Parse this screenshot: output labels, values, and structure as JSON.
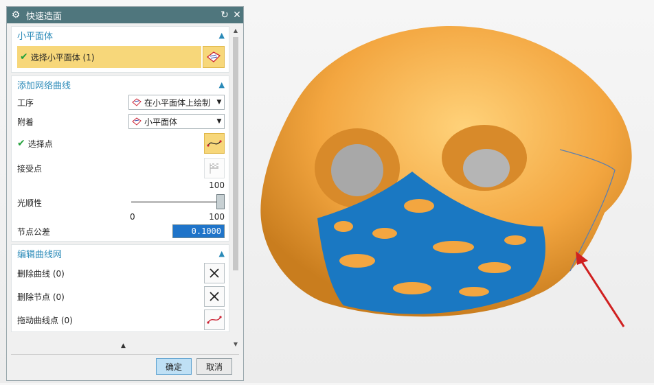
{
  "dialog": {
    "title": "快速造面",
    "sections": {
      "facet": {
        "header": "小平面体",
        "select_label": "选择小平面体 (1)"
      },
      "network": {
        "header": "添加网络曲线",
        "procedure_label": "工序",
        "procedure_value": "在小平面体上绘制",
        "attach_label": "附着",
        "attach_value": "小平面体",
        "select_point_label": "选择点",
        "accept_point_label": "接受点",
        "smoothness_label": "光顺性",
        "smoothness_min": "0",
        "smoothness_max": "100",
        "smoothness_max_top": "100",
        "smoothness_value": 1.0,
        "node_tolerance_label": "节点公差",
        "node_tolerance_value": "0.1000"
      },
      "edit": {
        "header": "编辑曲线网",
        "delete_curve_label": "删除曲线 (0)",
        "delete_node_label": "删除节点 (0)",
        "drag_point_label": "拖动曲线点 (0)"
      }
    },
    "buttons": {
      "ok": "确定",
      "cancel": "取消"
    }
  },
  "colors": {
    "titlebar": "#4f767d",
    "accent": "#2a8ab8",
    "selection": "#f7d77a",
    "model": "#f3a640",
    "patch": "#1a78c2"
  }
}
